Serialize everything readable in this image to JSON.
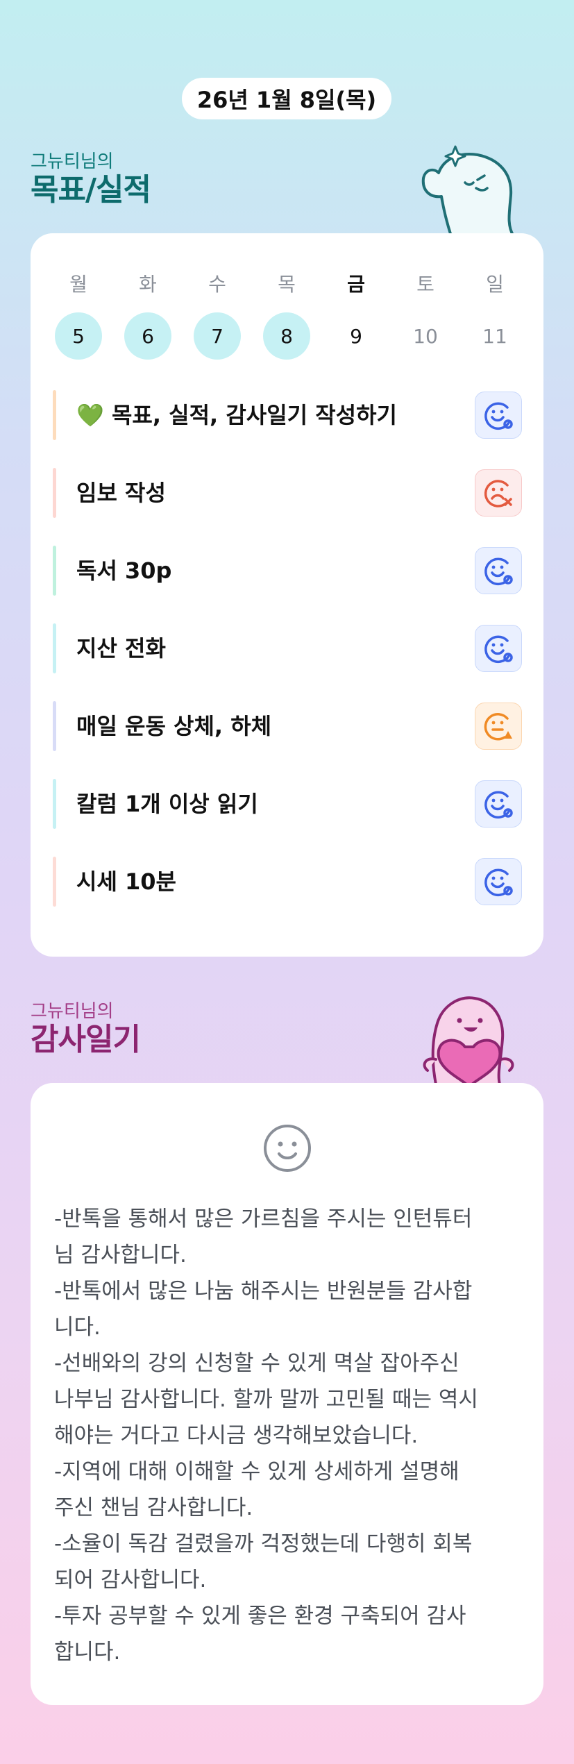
{
  "date": "26년 1월 8일(목)",
  "goals_section": {
    "owner": "그뉴티님의",
    "title": "목표/실적"
  },
  "week": [
    {
      "weekday": "월",
      "date": "5",
      "state": "done"
    },
    {
      "weekday": "화",
      "date": "6",
      "state": "done"
    },
    {
      "weekday": "수",
      "date": "7",
      "state": "done"
    },
    {
      "weekday": "목",
      "date": "8",
      "state": "done"
    },
    {
      "weekday": "금",
      "date": "9",
      "state": "today"
    },
    {
      "weekday": "토",
      "date": "10",
      "state": "future"
    },
    {
      "weekday": "일",
      "date": "11",
      "state": "future"
    }
  ],
  "goals": [
    {
      "label": "💚 목표, 실적, 감사일기 작성하기",
      "bar_color": "#fddcbc",
      "status": "achieved",
      "status_color": "#3b63e6"
    },
    {
      "label": "임보 작성",
      "bar_color": "#fdd7d2",
      "status": "failed",
      "status_color": "#e35a3f"
    },
    {
      "label": "독서 30p",
      "bar_color": "#bff1de",
      "status": "achieved",
      "status_color": "#3b63e6"
    },
    {
      "label": "지산 전화",
      "bar_color": "#c6f1f4",
      "status": "achieved",
      "status_color": "#3b63e6"
    },
    {
      "label": "매일 운동 상체, 하체",
      "bar_color": "#d8dcf7",
      "status": "partial",
      "status_color": "#f08a24"
    },
    {
      "label": "칼럼 1개 이상 읽기",
      "bar_color": "#c6f1f4",
      "status": "achieved",
      "status_color": "#3b63e6"
    },
    {
      "label": "시세 10분",
      "bar_color": "#fddcd6",
      "status": "achieved",
      "status_color": "#3b63e6"
    }
  ],
  "gratitude_section": {
    "owner": "그뉴티님의",
    "title": "감사일기"
  },
  "gratitude_text": "-반톡을 통해서 많은 가르침을 주시는 인턴튜터\n님 감사합니다.\n-반톡에서 많은 나눔 해주시는 반원분들 감사합\n니다.\n-선배와의 강의 신청할 수 있게 멱살 잡아주신\n나부님 감사합니다. 할까 말까 고민될 때는 역시\n해야는 거다고 다시금 생각해보았습니다.\n-지역에 대해 이해할 수 있게 상세하게 설명해\n주신 챈님 감사합니다.\n-소율이 독감 걸렸을까 걱정했는데 다행히 회복\n되어 감사합니다.\n-투자 공부할 수 있게 좋은 환경 구축되어 감사\n합니다."
}
